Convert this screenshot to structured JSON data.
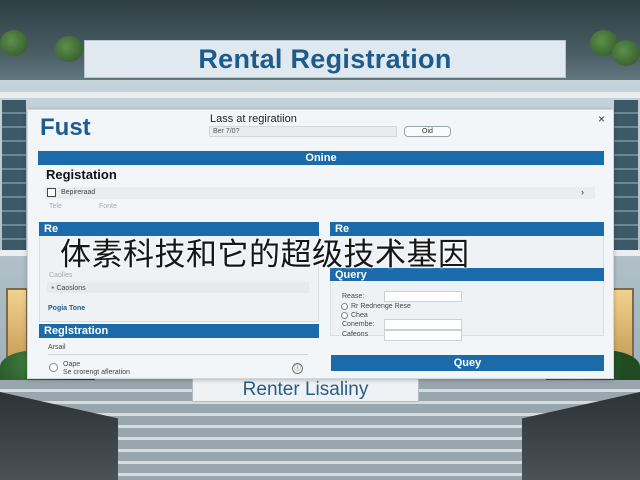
{
  "scene": {
    "banner_text": "Rental Registration",
    "bottom_sign_text": "Renter Lisaliny"
  },
  "dialog": {
    "close_glyph": "×",
    "logo": "Fust",
    "last_registration_label": "Lass at regiratiion",
    "registration_input_value": "Ber 7/0?",
    "old_button": "Oid",
    "online_bar": "Onine",
    "registration_heading": "Registation",
    "checkbox_row_label": "Bepireraad",
    "tabs": [
      "Tele",
      "Fonte"
    ],
    "left_panel": {
      "header": "Re",
      "rows": [
        "Caolles",
        "Caoslons"
      ],
      "footer_link": "Pogia Tone"
    },
    "right_panel": {
      "header": "Re",
      "query_bar": "Query",
      "form": [
        {
          "label": "Rease:"
        },
        {
          "label": "Rr Rednenge Rese",
          "radio": true
        },
        {
          "label": "Chea",
          "radio": true
        },
        {
          "label": "Conembe:"
        },
        {
          "label": "Cafeons"
        }
      ]
    },
    "registration_bar": "Reglstration",
    "arsail_label": "Arsail",
    "radio_options": [
      "Oape",
      "Se crorengt afleration"
    ],
    "info_glyph": "ⓘ",
    "query_button": "Quey"
  },
  "caption": "体素科技和它的超级技术基因",
  "colors": {
    "accent": "#1b6aa9",
    "logo": "#1c5c93",
    "banner_text": "#1d5b8c"
  }
}
